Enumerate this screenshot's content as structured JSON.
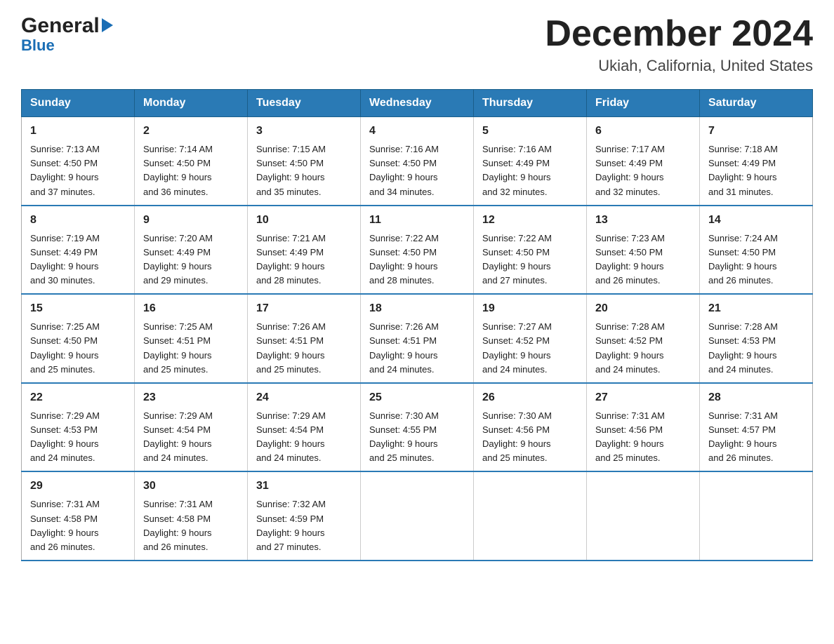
{
  "logo": {
    "general": "General",
    "blue": "Blue"
  },
  "title": "December 2024",
  "subtitle": "Ukiah, California, United States",
  "days_of_week": [
    "Sunday",
    "Monday",
    "Tuesday",
    "Wednesday",
    "Thursday",
    "Friday",
    "Saturday"
  ],
  "weeks": [
    [
      {
        "day": "1",
        "sunrise": "7:13 AM",
        "sunset": "4:50 PM",
        "daylight": "9 hours and 37 minutes."
      },
      {
        "day": "2",
        "sunrise": "7:14 AM",
        "sunset": "4:50 PM",
        "daylight": "9 hours and 36 minutes."
      },
      {
        "day": "3",
        "sunrise": "7:15 AM",
        "sunset": "4:50 PM",
        "daylight": "9 hours and 35 minutes."
      },
      {
        "day": "4",
        "sunrise": "7:16 AM",
        "sunset": "4:50 PM",
        "daylight": "9 hours and 34 minutes."
      },
      {
        "day": "5",
        "sunrise": "7:16 AM",
        "sunset": "4:49 PM",
        "daylight": "9 hours and 32 minutes."
      },
      {
        "day": "6",
        "sunrise": "7:17 AM",
        "sunset": "4:49 PM",
        "daylight": "9 hours and 32 minutes."
      },
      {
        "day": "7",
        "sunrise": "7:18 AM",
        "sunset": "4:49 PM",
        "daylight": "9 hours and 31 minutes."
      }
    ],
    [
      {
        "day": "8",
        "sunrise": "7:19 AM",
        "sunset": "4:49 PM",
        "daylight": "9 hours and 30 minutes."
      },
      {
        "day": "9",
        "sunrise": "7:20 AM",
        "sunset": "4:49 PM",
        "daylight": "9 hours and 29 minutes."
      },
      {
        "day": "10",
        "sunrise": "7:21 AM",
        "sunset": "4:49 PM",
        "daylight": "9 hours and 28 minutes."
      },
      {
        "day": "11",
        "sunrise": "7:22 AM",
        "sunset": "4:50 PM",
        "daylight": "9 hours and 28 minutes."
      },
      {
        "day": "12",
        "sunrise": "7:22 AM",
        "sunset": "4:50 PM",
        "daylight": "9 hours and 27 minutes."
      },
      {
        "day": "13",
        "sunrise": "7:23 AM",
        "sunset": "4:50 PM",
        "daylight": "9 hours and 26 minutes."
      },
      {
        "day": "14",
        "sunrise": "7:24 AM",
        "sunset": "4:50 PM",
        "daylight": "9 hours and 26 minutes."
      }
    ],
    [
      {
        "day": "15",
        "sunrise": "7:25 AM",
        "sunset": "4:50 PM",
        "daylight": "9 hours and 25 minutes."
      },
      {
        "day": "16",
        "sunrise": "7:25 AM",
        "sunset": "4:51 PM",
        "daylight": "9 hours and 25 minutes."
      },
      {
        "day": "17",
        "sunrise": "7:26 AM",
        "sunset": "4:51 PM",
        "daylight": "9 hours and 25 minutes."
      },
      {
        "day": "18",
        "sunrise": "7:26 AM",
        "sunset": "4:51 PM",
        "daylight": "9 hours and 24 minutes."
      },
      {
        "day": "19",
        "sunrise": "7:27 AM",
        "sunset": "4:52 PM",
        "daylight": "9 hours and 24 minutes."
      },
      {
        "day": "20",
        "sunrise": "7:28 AM",
        "sunset": "4:52 PM",
        "daylight": "9 hours and 24 minutes."
      },
      {
        "day": "21",
        "sunrise": "7:28 AM",
        "sunset": "4:53 PM",
        "daylight": "9 hours and 24 minutes."
      }
    ],
    [
      {
        "day": "22",
        "sunrise": "7:29 AM",
        "sunset": "4:53 PM",
        "daylight": "9 hours and 24 minutes."
      },
      {
        "day": "23",
        "sunrise": "7:29 AM",
        "sunset": "4:54 PM",
        "daylight": "9 hours and 24 minutes."
      },
      {
        "day": "24",
        "sunrise": "7:29 AM",
        "sunset": "4:54 PM",
        "daylight": "9 hours and 24 minutes."
      },
      {
        "day": "25",
        "sunrise": "7:30 AM",
        "sunset": "4:55 PM",
        "daylight": "9 hours and 25 minutes."
      },
      {
        "day": "26",
        "sunrise": "7:30 AM",
        "sunset": "4:56 PM",
        "daylight": "9 hours and 25 minutes."
      },
      {
        "day": "27",
        "sunrise": "7:31 AM",
        "sunset": "4:56 PM",
        "daylight": "9 hours and 25 minutes."
      },
      {
        "day": "28",
        "sunrise": "7:31 AM",
        "sunset": "4:57 PM",
        "daylight": "9 hours and 26 minutes."
      }
    ],
    [
      {
        "day": "29",
        "sunrise": "7:31 AM",
        "sunset": "4:58 PM",
        "daylight": "9 hours and 26 minutes."
      },
      {
        "day": "30",
        "sunrise": "7:31 AM",
        "sunset": "4:58 PM",
        "daylight": "9 hours and 26 minutes."
      },
      {
        "day": "31",
        "sunrise": "7:32 AM",
        "sunset": "4:59 PM",
        "daylight": "9 hours and 27 minutes."
      },
      null,
      null,
      null,
      null
    ]
  ],
  "labels": {
    "sunrise": "Sunrise:",
    "sunset": "Sunset:",
    "daylight": "Daylight:"
  }
}
